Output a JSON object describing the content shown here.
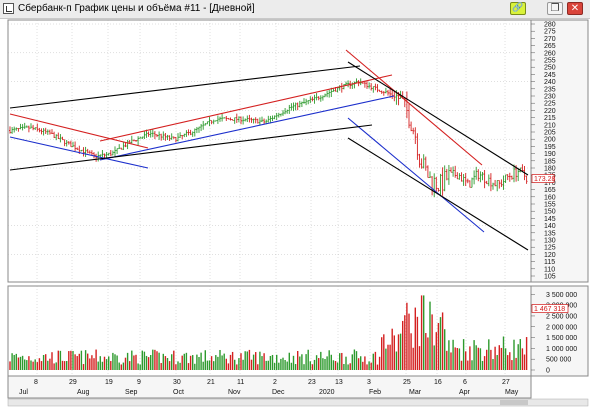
{
  "window": {
    "title": "Сбербанк-п График цены и объёма #11 - [Дневной]",
    "buttons": [
      {
        "icon": "link-icon",
        "glyph": "🔗"
      },
      {
        "icon": "restore-icon",
        "glyph": "❐"
      },
      {
        "icon": "close-icon",
        "glyph": "✕"
      }
    ]
  },
  "colors": {
    "up": "#2d9a2d",
    "down": "#d42020",
    "red_line": "#d42020",
    "blue_line": "#1c2fcc",
    "black_line": "#000000",
    "grid": "#b0b0b0"
  },
  "price_axis_labels": [
    "280",
    "275",
    "270",
    "265",
    "260",
    "255",
    "250",
    "245",
    "240",
    "235",
    "230",
    "225",
    "220",
    "215",
    "210",
    "205",
    "200",
    "195",
    "190",
    "185",
    "180",
    "175",
    "170",
    "165",
    "160",
    "155",
    "150",
    "145",
    "140",
    "135",
    "130",
    "125",
    "120",
    "115",
    "110",
    "105"
  ],
  "last_price": "173.28",
  "volume_axis_labels": [
    "3 500 000",
    "3 000 000",
    "2 500 000",
    "2 000 000",
    "1 500 000",
    "1 000 000",
    "500 000",
    "0"
  ],
  "last_volume": "1 467 318",
  "date_labels_top": [
    "8",
    "29",
    "19",
    "9",
    "30",
    "21",
    "11",
    "2",
    "23",
    "13",
    "3",
    "25",
    "16",
    "6",
    "27"
  ],
  "date_labels_bottom": [
    "Jul",
    "Aug",
    "Sep",
    "Oct",
    "Nov",
    "Dec",
    "2020",
    "Feb",
    "Mar",
    "Apr",
    "May"
  ],
  "chart_data": {
    "type": "bar",
    "price_range": [
      100,
      285
    ],
    "volume_range": [
      0,
      3700000
    ],
    "trendlines": [
      {
        "color": "red",
        "points": [
          [
            "Jul",
            "210"
          ],
          [
            "Sep",
            "188"
          ]
        ]
      },
      {
        "color": "red",
        "points": [
          [
            "Aug",
            "200"
          ],
          [
            "Feb",
            "245"
          ]
        ]
      },
      {
        "color": "red",
        "points": [
          [
            "Jan",
            "262"
          ],
          [
            "Apr",
            "185"
          ]
        ]
      },
      {
        "color": "blue",
        "points": [
          [
            "Jul",
            "200"
          ],
          [
            "Sep",
            "180"
          ]
        ]
      },
      {
        "color": "blue",
        "points": [
          [
            "Aug",
            "186"
          ],
          [
            "Feb",
            "230"
          ]
        ]
      },
      {
        "color": "blue",
        "points": [
          [
            "Feb",
            "215"
          ],
          [
            "Apr",
            "135"
          ]
        ]
      },
      {
        "color": "black",
        "points": [
          [
            "Jul",
            "220"
          ],
          [
            "Feb",
            "250"
          ]
        ]
      },
      {
        "color": "black",
        "points": [
          [
            "Jul",
            "180"
          ],
          [
            "Feb",
            "210"
          ]
        ]
      },
      {
        "color": "black",
        "points": [
          [
            "Jan",
            "250"
          ],
          [
            "May",
            "178"
          ]
        ]
      },
      {
        "color": "black",
        "points": [
          [
            "Feb",
            "200"
          ],
          [
            "May",
            "125"
          ]
        ]
      }
    ]
  }
}
